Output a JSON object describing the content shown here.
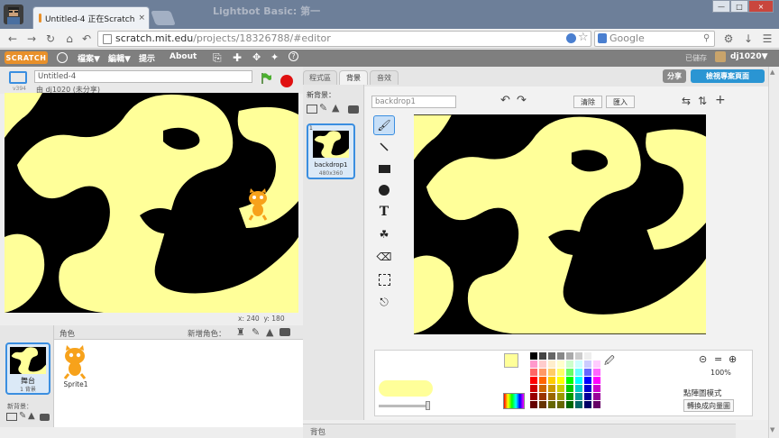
{
  "browser": {
    "tab_title": "Untitled-4 正在Scratch",
    "tab_close": "×",
    "ghost_title": "Lightbot Basic: 第一",
    "url_host": "scratch.mit.edu",
    "url_path": "/projects/18326788/#editor",
    "search_placeholder": "Google",
    "win_min": "—",
    "win_max": "□",
    "win_close": "×"
  },
  "menu": {
    "logo": "SCRATCH",
    "file": "檔案▼",
    "edit": "編輯▼",
    "tips": "提示",
    "about": "About",
    "saved": "已儲存",
    "user": "dj1020▼"
  },
  "project": {
    "title": "Untitled-4",
    "owner": "由 dj1020 (未分享)",
    "version": "v394",
    "coords_x_label": "x:",
    "coords_x": "240",
    "coords_y_label": "y:",
    "coords_y": "180"
  },
  "sprites": {
    "header": "角色",
    "new_sprite": "新增角色：",
    "stage_label": "舞台",
    "stage_count": "1 背景",
    "new_backdrop": "新背景：",
    "sprite1": "Sprite1"
  },
  "tabs": {
    "scripts": "程式區",
    "backdrops": "背景",
    "sounds": "音效"
  },
  "backdrops": {
    "new_label": "新背景：",
    "item_name": "backdrop1",
    "item_size": "480x360",
    "index": "1"
  },
  "editor": {
    "name_placeholder": "backdrop1",
    "clear": "清除",
    "import": "匯入",
    "zoom": "100%",
    "mode_label": "點陣圖模式",
    "convert": "轉換成向量圖",
    "share": "分享",
    "see_project": "檢視專案頁面"
  },
  "bottom": {
    "backpack": "背包"
  },
  "colors": {
    "stage_bg": "#000000",
    "path": "#ffff99",
    "accent": "#3a8ee0",
    "scratch_orange": "#e8902a"
  }
}
